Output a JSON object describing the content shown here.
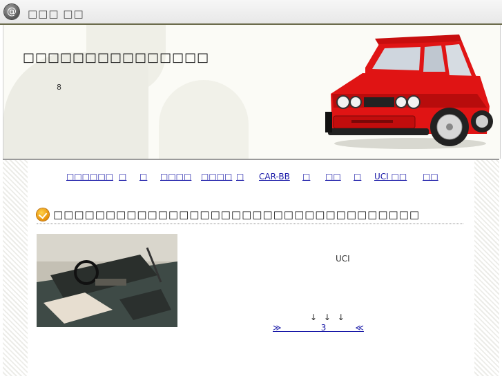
{
  "topbar": {
    "at_glyph": "@",
    "site_title": "□□□ □□"
  },
  "header": {
    "headline": "□□□□□□□□□□□□□□□",
    "count": "8",
    "car_color": "#e01414"
  },
  "nav": {
    "items": [
      {
        "label": "□□□□□□"
      },
      {
        "label": "□"
      },
      {
        "label": "□"
      },
      {
        "label": "□□□□"
      },
      {
        "label": "□□□□"
      },
      {
        "label": "□"
      },
      {
        "label": "CAR-BB"
      },
      {
        "label": "□"
      },
      {
        "label": "□□"
      },
      {
        "label": "□"
      },
      {
        "label": "UCI □□"
      },
      {
        "label": "□□"
      }
    ]
  },
  "section": {
    "title": "□□□□□□□□□□□□□□□□□□□□□□□□□□□□□□□□□□□",
    "uci_label": "UCI",
    "arrows": "↓ ↓ ↓",
    "more_link": "≫               3           ≪"
  },
  "colors": {
    "link": "#1a1aa8",
    "rule": "#6a6a4a"
  }
}
